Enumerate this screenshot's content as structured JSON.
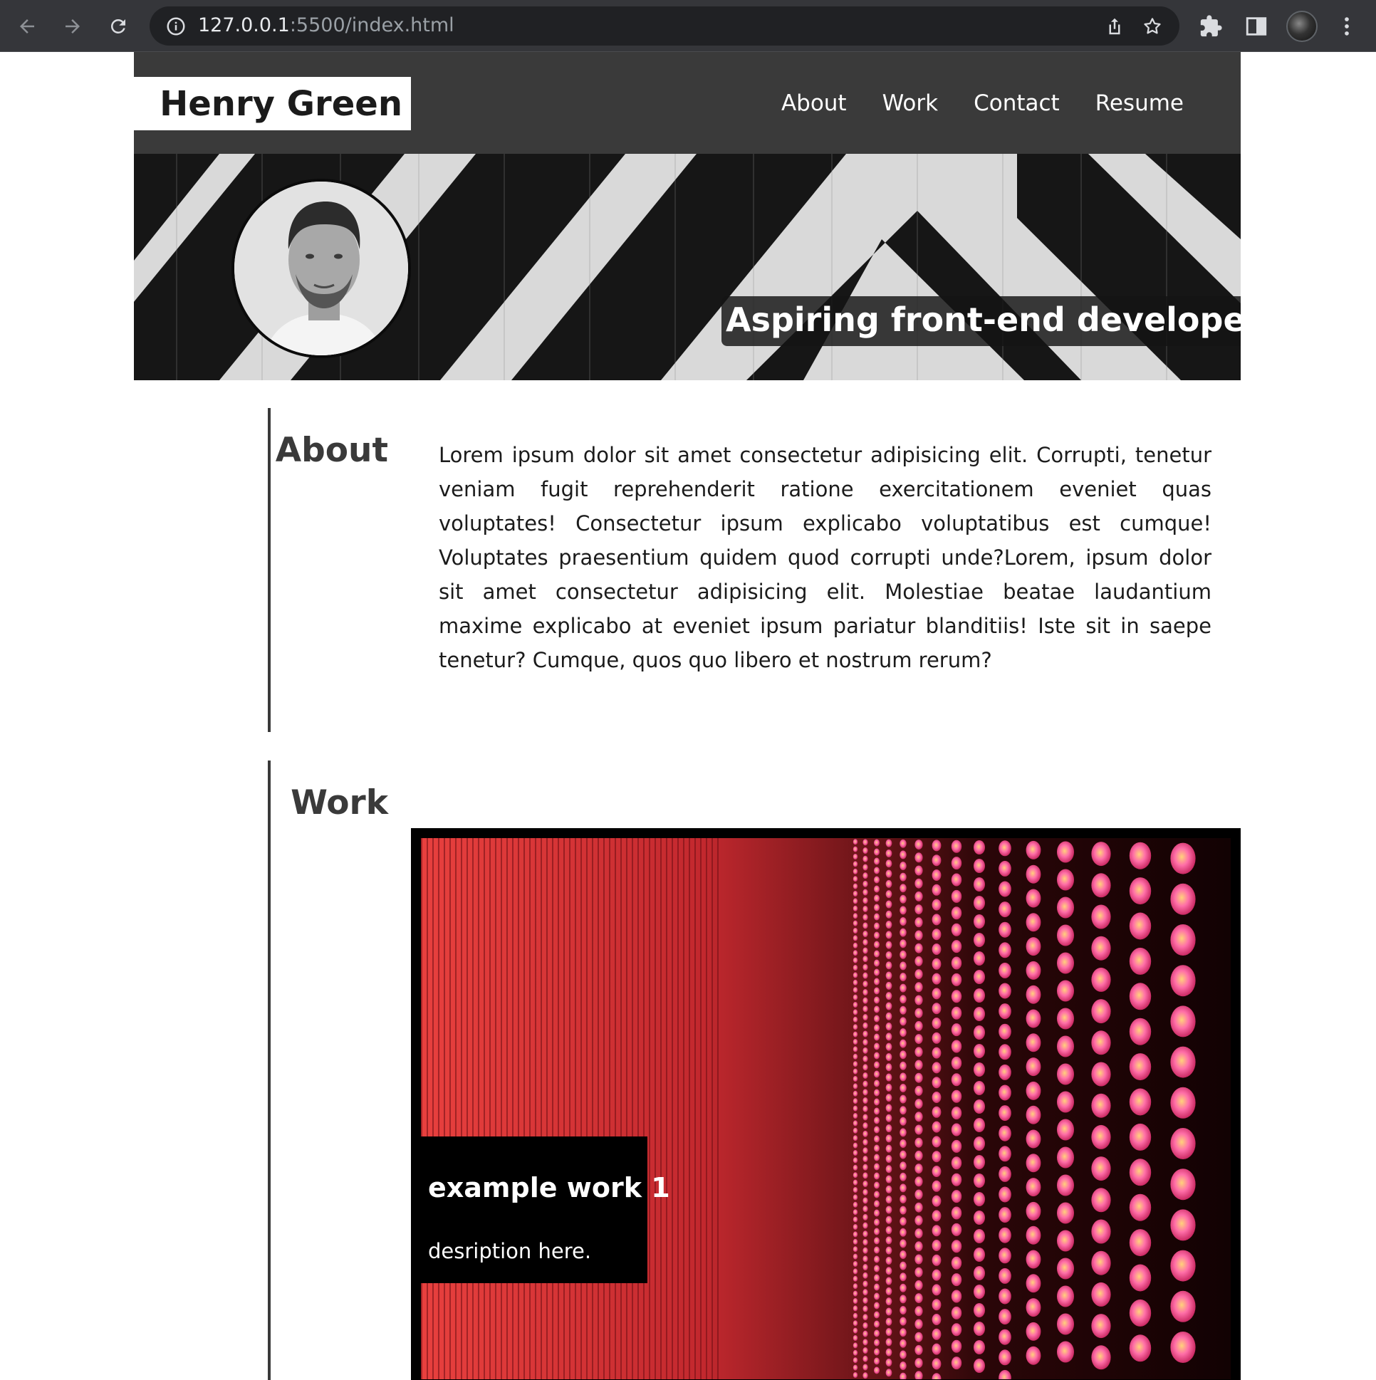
{
  "browser": {
    "url_host": "127.0.0.1",
    "url_rest": ":5500/index.html"
  },
  "site": {
    "brand": "Henry Green",
    "nav": [
      "About",
      "Work",
      "Contact",
      "Resume"
    ],
    "tagline": "Aspiring front-end developer"
  },
  "about": {
    "heading": "About",
    "text": "Lorem ipsum dolor sit amet consectetur adipisicing elit. Corrupti, tenetur veniam fugit reprehenderit ratione exercitationem eveniet quas voluptates! Consectetur ipsum explicabo voluptatibus est cumque! Voluptates praesentium quidem quod corrupti unde?Lorem, ipsum dolor sit amet consectetur adipisicing elit. Molestiae beatae laudantium maxime explicabo at eveniet ipsum pariatur blanditiis! Iste sit in saepe tenetur? Cumque, quos quo libero et nostrum rerum?"
  },
  "work": {
    "heading": "Work",
    "items": [
      {
        "title": "example work 1",
        "description": "desription here."
      }
    ]
  },
  "colors": {
    "header_bg": "#3a3a3a",
    "chrome_bg": "#35363a",
    "accent_red": "#e8403e"
  }
}
